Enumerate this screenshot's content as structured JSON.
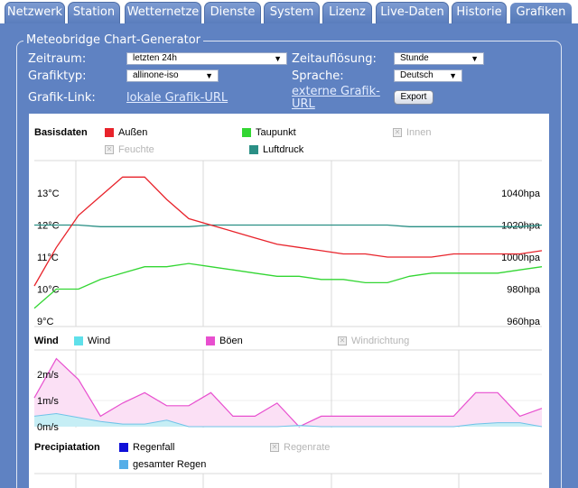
{
  "tabs": [
    {
      "label": "Netzwerk",
      "active": false
    },
    {
      "label": "Station",
      "active": false
    },
    {
      "label": "Wetternetze",
      "active": false
    },
    {
      "label": "Dienste",
      "active": false
    },
    {
      "label": "System",
      "active": false
    },
    {
      "label": "Lizenz",
      "active": false
    },
    {
      "label": "Live-Daten",
      "active": false
    },
    {
      "label": "Historie",
      "active": false
    },
    {
      "label": "Grafiken",
      "active": true
    }
  ],
  "form": {
    "legend": "Meteobridge Chart-Generator",
    "zeitraum_label": "Zeitraum:",
    "zeitraum_value": "letzten 24h",
    "zeitaufloesung_label": "Zeitauflösung:",
    "zeitaufloesung_value": "Stunde",
    "grafiktyp_label": "Grafiktyp:",
    "grafiktyp_value": "allinone-iso",
    "sprache_label": "Sprache:",
    "sprache_value": "Deutsch",
    "grafiklink_label": "Grafik-Link:",
    "lokale_link": "lokale Grafik-URL",
    "externe_link_line1": "externe Grafik-",
    "externe_link_line2": "URL",
    "export_button": "Export"
  },
  "colors": {
    "aussen": "#e8232b",
    "taupunkt": "#33d633",
    "luftdruck": "#2a8f85",
    "wind": "#5fe0ea",
    "boeen": "#e84fcf",
    "regenfall": "#1010d8",
    "gesamter_regen": "#55aee8"
  },
  "chart_data": [
    {
      "type": "line",
      "title": "Basisdaten",
      "legend": [
        "Außen",
        "Taupunkt",
        "Innen",
        "Feuchte",
        "Luftdruck"
      ],
      "legend_hidden": [
        "Innen",
        "Feuchte"
      ],
      "y_left_ticks": [
        "13°C",
        "12°C",
        "11°C",
        "10°C",
        "9°C"
      ],
      "y_right_ticks": [
        "1040hpa",
        "1020hpa",
        "1000hpa",
        "980hpa",
        "960hpa"
      ],
      "ylim_temp": [
        9,
        13
      ],
      "ylim_pressure": [
        960,
        1040
      ],
      "x": [
        0,
        1,
        2,
        3,
        4,
        5,
        6,
        7,
        8,
        9,
        10,
        11,
        12,
        13,
        14,
        15,
        16,
        17,
        18,
        19,
        20,
        21,
        22,
        23,
        24
      ],
      "series": [
        {
          "name": "Außen",
          "axis": "temp",
          "values": [
            10.1,
            11.3,
            12.3,
            12.9,
            13.5,
            13.5,
            12.8,
            12.2,
            12.0,
            11.8,
            11.6,
            11.4,
            11.3,
            11.2,
            11.1,
            11.1,
            11.0,
            11.0,
            11.0,
            11.1,
            11.1,
            11.1,
            11.1,
            11.2,
            11.3
          ]
        },
        {
          "name": "Taupunkt",
          "axis": "temp",
          "values": [
            9.4,
            10.0,
            10.0,
            10.3,
            10.5,
            10.7,
            10.7,
            10.8,
            10.7,
            10.6,
            10.5,
            10.4,
            10.4,
            10.3,
            10.3,
            10.2,
            10.2,
            10.4,
            10.5,
            10.5,
            10.5,
            10.5,
            10.6,
            10.7,
            10.7
          ]
        },
        {
          "name": "Luftdruck",
          "axis": "pressure",
          "values": [
            1020,
            1020,
            1020,
            1019,
            1019,
            1019,
            1019,
            1019,
            1020,
            1020,
            1020,
            1020,
            1020,
            1020,
            1020,
            1020,
            1020,
            1019,
            1019,
            1019,
            1019,
            1019,
            1019,
            1020,
            1020
          ]
        }
      ]
    },
    {
      "type": "area",
      "title": "Wind",
      "legend": [
        "Wind",
        "Böen",
        "Windrichtung"
      ],
      "legend_hidden": [
        "Windrichtung"
      ],
      "y_left_ticks": [
        "2m/s",
        "1m/s",
        "0m/s"
      ],
      "ylim": [
        0,
        2.6
      ],
      "x": [
        0,
        1,
        2,
        3,
        4,
        5,
        6,
        7,
        8,
        9,
        10,
        11,
        12,
        13,
        14,
        15,
        16,
        17,
        18,
        19,
        20,
        21,
        22,
        23
      ],
      "series": [
        {
          "name": "Böen",
          "values": [
            1.1,
            2.6,
            1.8,
            0.4,
            0.9,
            1.3,
            0.8,
            0.8,
            1.3,
            0.4,
            0.4,
            0.9,
            0.0,
            0.4,
            0.4,
            0.4,
            0.4,
            0.4,
            0.4,
            0.4,
            1.3,
            1.3,
            0.4,
            0.7,
            1.3
          ]
        },
        {
          "name": "Wind",
          "values": [
            0.4,
            0.5,
            0.35,
            0.2,
            0.1,
            0.1,
            0.25,
            0.0,
            0.0,
            0.0,
            0.0,
            0.0,
            0.05,
            0.0,
            0.0,
            0.0,
            0.0,
            0.0,
            0.0,
            0.0,
            0.1,
            0.15,
            0.15,
            0.0,
            0.1
          ]
        }
      ]
    },
    {
      "type": "bar",
      "title": "Precipiatation",
      "legend": [
        "Regenfall",
        "Regenrate",
        "gesamter Regen"
      ],
      "legend_hidden": [
        "Regenrate"
      ],
      "series": []
    }
  ],
  "legend_labels": {
    "basis": {
      "aussen": "Außen",
      "taupunkt": "Taupunkt",
      "innen": "Innen",
      "feuchte": "Feuchte",
      "luftdruck": "Luftdruck"
    },
    "wind": {
      "wind": "Wind",
      "boeen": "Böen",
      "windrichtung": "Windrichtung"
    },
    "precip": {
      "regenfall": "Regenfall",
      "regenrate": "Regenrate",
      "gesamter_regen": "gesamter Regen"
    }
  },
  "chart_titles": {
    "basis": "Basisdaten",
    "wind": "Wind",
    "precip": "Precipiatation"
  }
}
